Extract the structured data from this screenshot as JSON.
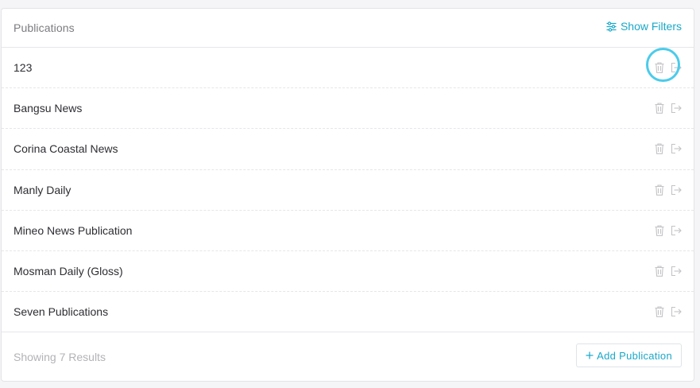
{
  "header": {
    "title": "Publications",
    "filters_label": "Show Filters",
    "filters_icon": "sliders-icon"
  },
  "publications": [
    {
      "name": "123"
    },
    {
      "name": "Bangsu News"
    },
    {
      "name": "Corina Coastal News"
    },
    {
      "name": "Manly Daily"
    },
    {
      "name": "Mineo News Publication"
    },
    {
      "name": "Mosman Daily (Gloss)"
    },
    {
      "name": "Seven Publications"
    }
  ],
  "row_actions": {
    "delete_icon": "trash-icon",
    "open_icon": "exit-icon"
  },
  "footer": {
    "results_text": "Showing 7 Results",
    "add_label": "Add Publication",
    "add_icon": "plus-icon"
  },
  "colors": {
    "accent": "#19a8c9",
    "highlight": "#4ccbea",
    "muted_icon": "#c4c4c8"
  }
}
